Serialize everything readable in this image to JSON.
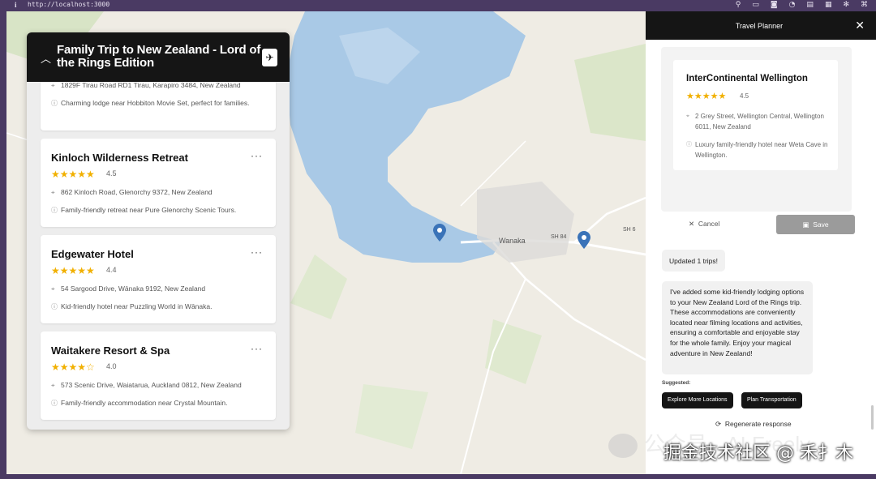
{
  "browser": {
    "info_icon": "info-icon",
    "url": "http://localhost:3000",
    "tools": [
      "link-icon",
      "window-icon",
      "camera-icon",
      "wifi-icon",
      "layout-icon",
      "grid-icon",
      "settings-icon",
      "game-icon"
    ]
  },
  "map": {
    "places": [
      "Wanaka",
      "SH 84",
      "SH 6"
    ]
  },
  "trip": {
    "title": "Family Trip to New Zealand - Lord of the Rings Edition",
    "collapse_icon": "chevron-up-icon",
    "action_icon": "plane-icon",
    "partial_item": {
      "address": "1829F Tirau Road RD1 Tirau, Karapiro 3484, New Zealand",
      "description": "Charming lodge near Hobbiton Movie Set, perfect for families."
    },
    "items": [
      {
        "name": "Kinloch Wilderness Retreat",
        "stars": "★★★★★",
        "rating": "4.5",
        "address": "862 Kinloch Road, Glenorchy 9372, New Zealand",
        "description": "Family-friendly retreat near Pure Glenorchy Scenic Tours."
      },
      {
        "name": "Edgewater Hotel",
        "stars": "★★★★★",
        "rating": "4.4",
        "address": "54 Sargood Drive, Wānaka 9192, New Zealand",
        "description": "Kid-friendly hotel near Puzzling World in Wānaka."
      },
      {
        "name": "Waitakere Resort & Spa",
        "stars": "★★★★☆",
        "rating": "4.0",
        "address": "573 Scenic Drive, Waiatarua, Auckland 0812, New Zealand",
        "description": "Family-friendly accommodation near Crystal Mountain."
      }
    ],
    "more_label": "···"
  },
  "planner": {
    "title": "Travel Planner",
    "close_icon": "close-icon",
    "hotel": {
      "name": "InterContinental Wellington",
      "stars": "★★★★★",
      "rating": "4.5",
      "address": "2 Grey Street, Wellington Central, Wellington 6011, New Zealand",
      "description": "Luxury family-friendly hotel near Weta Cave in Wellington."
    },
    "cancel_label": "Cancel",
    "save_label": "Save",
    "updated_message": "Updated 1 trips!",
    "assistant_message": "I've added some kid-friendly lodging options to your New Zealand Lord of the Rings trip. These accommodations are conveniently located near filming locations and activities, ensuring a comfortable and enjoyable stay for the whole family. Enjoy your magical adventure in New Zealand!",
    "suggested_label": "Suggested:",
    "suggestions": [
      "Explore More Locations",
      "Plan Transportation"
    ],
    "regenerate_label": "Regenerate response"
  },
  "watermark": {
    "line1": "公众号 · AI Freely",
    "line2": "掘金技术社区 @ 禾扌木"
  },
  "colors": {
    "header_bg": "#151515",
    "star": "#f1b000",
    "water": "#a9c9e6",
    "pin": "#3a73b8",
    "frame": "#4a3a63"
  }
}
